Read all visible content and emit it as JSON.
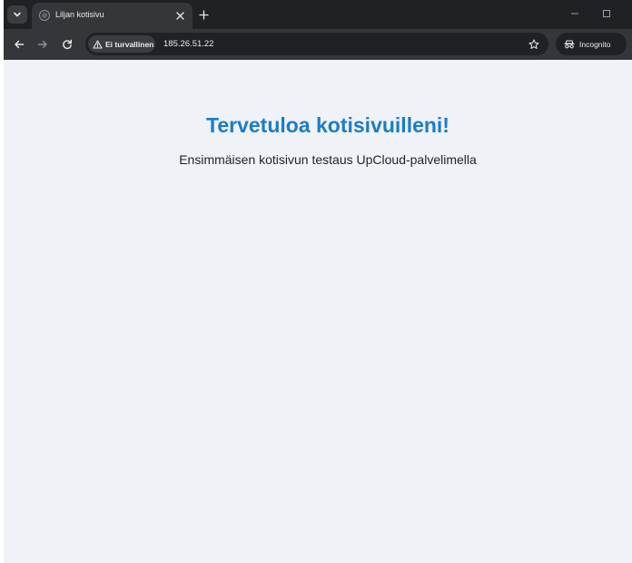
{
  "browser": {
    "tab": {
      "title": "Liljan kotisivu"
    },
    "address_bar": {
      "security_label": "Ei turvallinen",
      "url": "185.26.51.22"
    },
    "incognito_label": "Incognito",
    "icons": {
      "tab_list": "chevron-down-icon",
      "favicon": "globe-icon",
      "tab_close": "close-icon",
      "new_tab": "plus-icon",
      "minimize": "minimize-icon",
      "maximize": "maximize-icon",
      "back": "arrow-left-icon",
      "forward": "arrow-right-icon",
      "reload": "reload-icon",
      "security": "warning-triangle-icon",
      "bookmark": "star-icon",
      "incognito": "incognito-icon"
    },
    "colors": {
      "tabstrip": "#202124",
      "toolbar": "#35363a",
      "page_background": "#eff2f6"
    }
  },
  "page": {
    "heading": "Tervetuloa kotisivuilleni!",
    "subtitle": "Ensimmäisen kotisivun testaus UpCloud-palvelimella",
    "colors": {
      "heading": "#1c7cc7",
      "text": "#1f2328"
    }
  }
}
